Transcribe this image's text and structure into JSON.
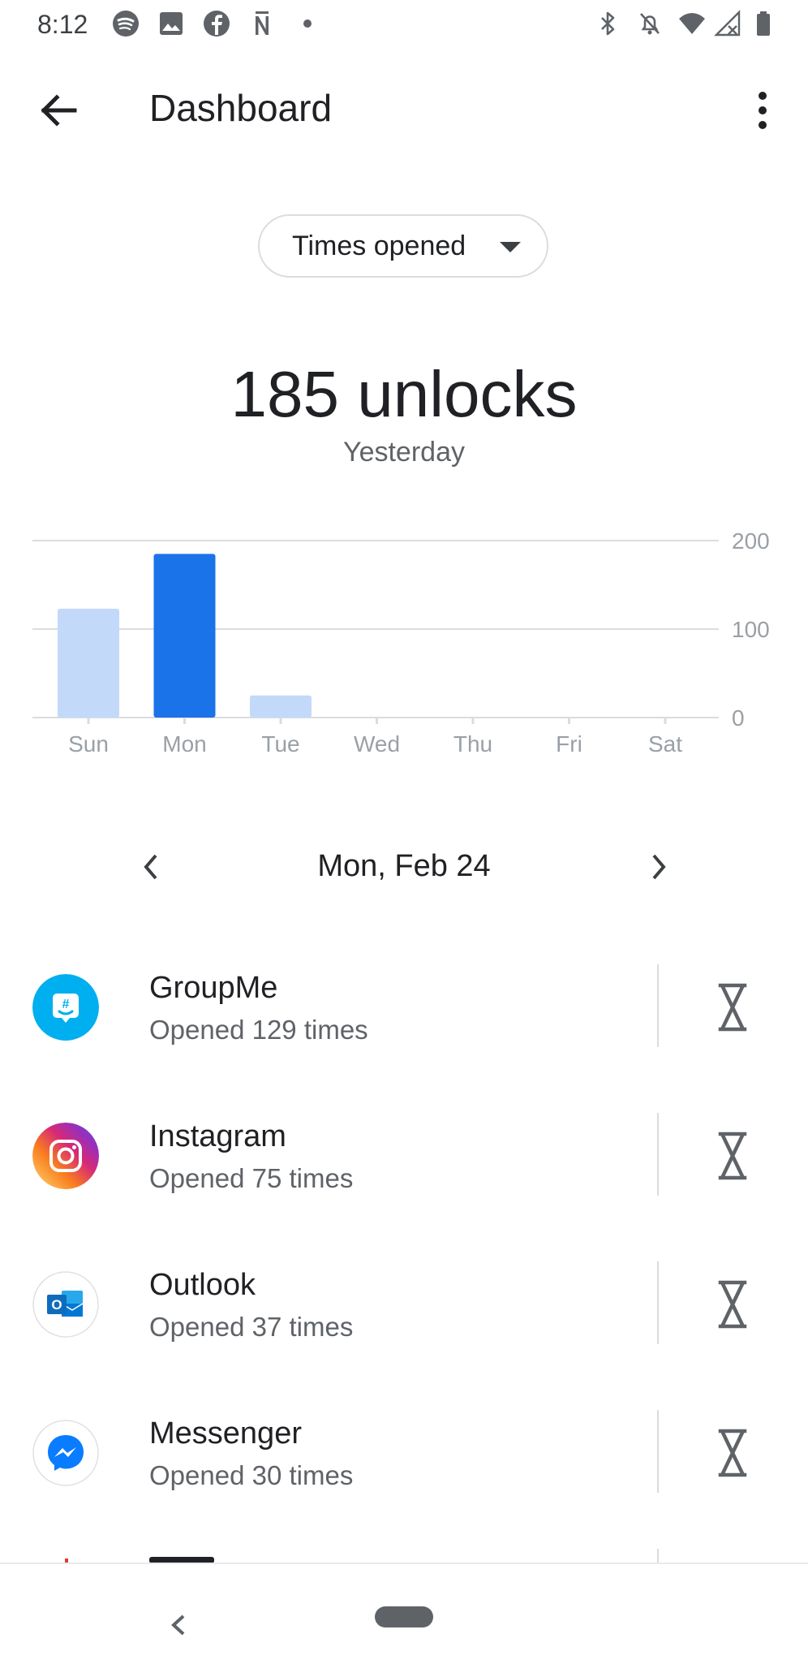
{
  "status_bar": {
    "time": "8:12",
    "left_icons": [
      "spotify-icon",
      "image-icon",
      "facebook-icon",
      "nyt-icon",
      "dot-icon"
    ],
    "right_icons": [
      "bluetooth-icon",
      "notifications-off-icon",
      "wifi-icon",
      "signal-icon",
      "battery-icon"
    ]
  },
  "toolbar": {
    "title": "Dashboard",
    "back_icon": "arrow-back-icon",
    "menu_icon": "more-vert-icon"
  },
  "selector": {
    "label": "Times opened",
    "caret_icon": "caret-down-icon"
  },
  "summary": {
    "value": "185 unlocks",
    "period": "Yesterday"
  },
  "chart_data": {
    "type": "bar",
    "categories": [
      "Sun",
      "Mon",
      "Tue",
      "Wed",
      "Thu",
      "Fri",
      "Sat"
    ],
    "values": [
      123,
      185,
      25,
      0,
      0,
      0,
      0
    ],
    "highlighted": "Mon",
    "ylim": [
      0,
      200
    ],
    "yticks": [
      0,
      100,
      200
    ],
    "title": "",
    "xlabel": "",
    "ylabel": "",
    "grid": true,
    "colors": {
      "bar": "#c3d9fa",
      "highlight": "#1a73e8",
      "grid": "#dadce0",
      "tick": "#9aa0a6"
    }
  },
  "date_nav": {
    "label": "Mon, Feb 24",
    "prev_icon": "chevron-left-icon",
    "next_icon": "chevron-right-icon"
  },
  "apps": [
    {
      "name": "GroupMe",
      "sub": "Opened 129 times",
      "icon": "groupme-icon",
      "timer_icon": "hourglass-icon"
    },
    {
      "name": "Instagram",
      "sub": "Opened 75 times",
      "icon": "instagram-icon",
      "timer_icon": "hourglass-icon"
    },
    {
      "name": "Outlook",
      "sub": "Opened 37 times",
      "icon": "outlook-icon",
      "timer_icon": "hourglass-icon"
    },
    {
      "name": "Messenger",
      "sub": "Opened 30 times",
      "icon": "messenger-icon",
      "timer_icon": "hourglass-icon"
    }
  ],
  "nav_bar": {
    "back_icon": "nav-back-icon",
    "home_icon": "home-pill-icon"
  }
}
